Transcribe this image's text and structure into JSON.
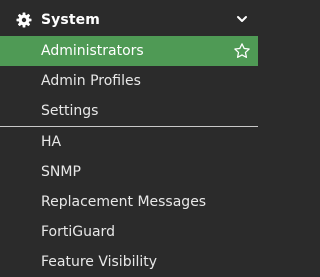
{
  "menu": {
    "header": {
      "title": "System",
      "icon": "gear-icon",
      "toggle_icon": "chevron-down-icon"
    },
    "items": [
      {
        "label": "Administrators",
        "active": true,
        "favorite_icon": "star-outline-icon"
      },
      {
        "label": "Admin Profiles",
        "active": false
      },
      {
        "label": "Settings",
        "active": false
      },
      {
        "label": "HA",
        "active": false
      },
      {
        "label": "SNMP",
        "active": false
      },
      {
        "label": "Replacement Messages",
        "active": false
      },
      {
        "label": "FortiGuard",
        "active": false
      },
      {
        "label": "Feature Visibility",
        "active": false
      }
    ]
  },
  "colors": {
    "background": "#2b2b2b",
    "active_item": "#4f9a55",
    "text": "#e8e8e8",
    "divider": "#c8c8c8"
  }
}
